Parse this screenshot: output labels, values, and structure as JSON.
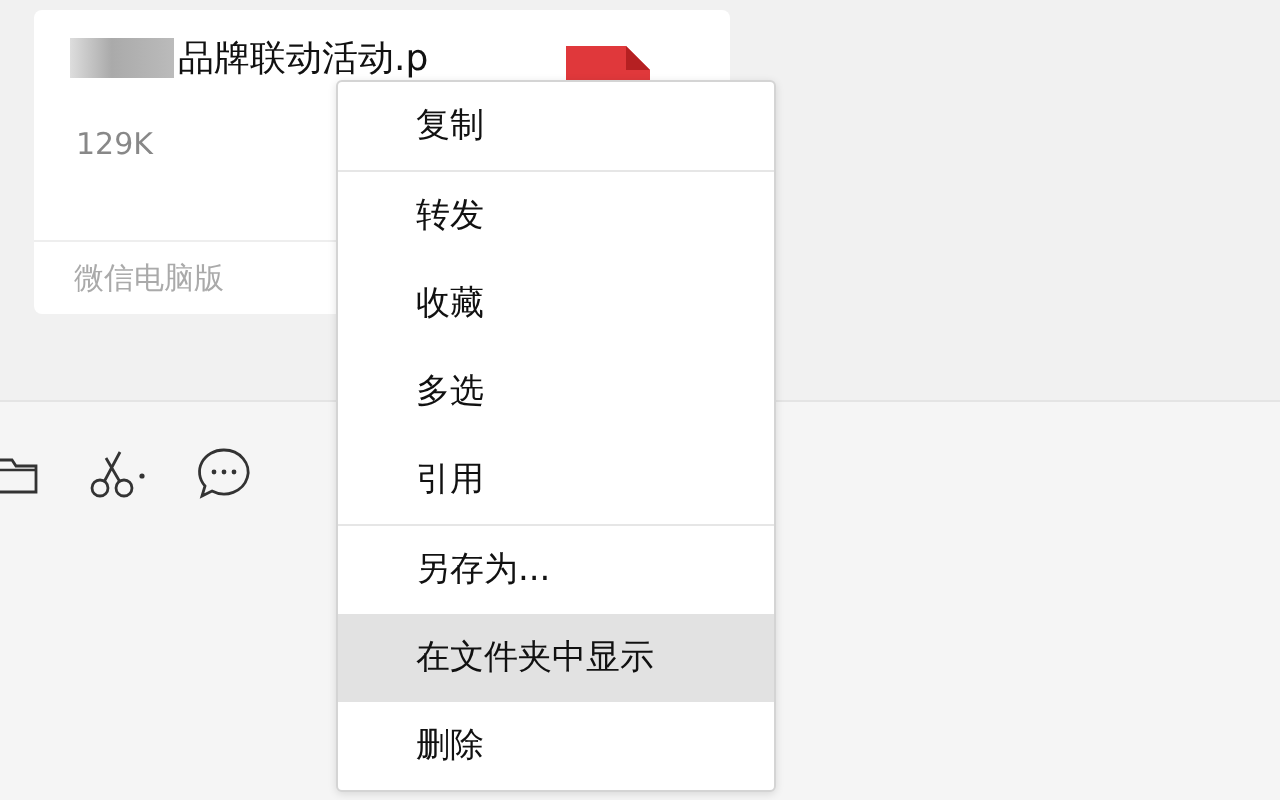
{
  "file_card": {
    "file_name": "品牌联动活动.p",
    "size": "129K",
    "source": "微信电脑版"
  },
  "context_menu": {
    "groups": [
      [
        {
          "label": "复制",
          "selected": false
        }
      ],
      [
        {
          "label": "转发",
          "selected": false
        },
        {
          "label": "收藏",
          "selected": false
        },
        {
          "label": "多选",
          "selected": false
        },
        {
          "label": "引用",
          "selected": false
        }
      ],
      [
        {
          "label": "另存为...",
          "selected": false
        },
        {
          "label": "在文件夹中显示",
          "selected": true
        },
        {
          "label": "删除",
          "selected": false
        }
      ]
    ]
  }
}
